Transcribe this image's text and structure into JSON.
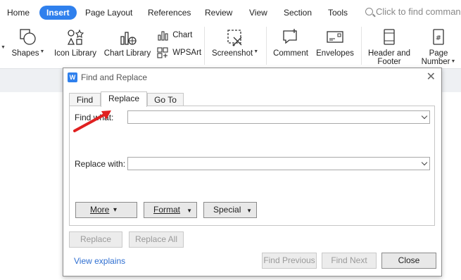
{
  "ribbon": {
    "tabs": [
      "Home",
      "Insert",
      "Page Layout",
      "References",
      "Review",
      "View",
      "Section",
      "Tools"
    ],
    "active_tab": "Insert",
    "search_placeholder": "Click to find comman"
  },
  "toolbar": {
    "shapes": "Shapes",
    "icon_library": "Icon Library",
    "chart_library": "Chart Library",
    "chart": "Chart",
    "wpsart": "WPSArt",
    "screenshot": "Screenshot",
    "comment": "Comment",
    "envelopes": "Envelopes",
    "header_footer_line1": "Header and",
    "header_footer_line2": "Footer",
    "page_number_line1": "Page",
    "page_number_line2": "Number"
  },
  "dialog": {
    "title": "Find and Replace",
    "logo": "W",
    "tabs": {
      "find": "Find",
      "replace": "Replace",
      "goto": "Go To"
    },
    "active_tab": "Replace",
    "find_what_label": "Find what:",
    "find_what_value": "",
    "replace_with_label": "Replace with:",
    "replace_with_value": "",
    "buttons": {
      "more": "More",
      "format": "Format",
      "special": "Special",
      "replace": "Replace",
      "replace_all": "Replace All",
      "find_previous": "Find Previous",
      "find_next": "Find Next",
      "close": "Close"
    },
    "view_explains": "View explains"
  },
  "colors": {
    "accent": "#2f80ed",
    "annotation_arrow": "#e02020"
  }
}
